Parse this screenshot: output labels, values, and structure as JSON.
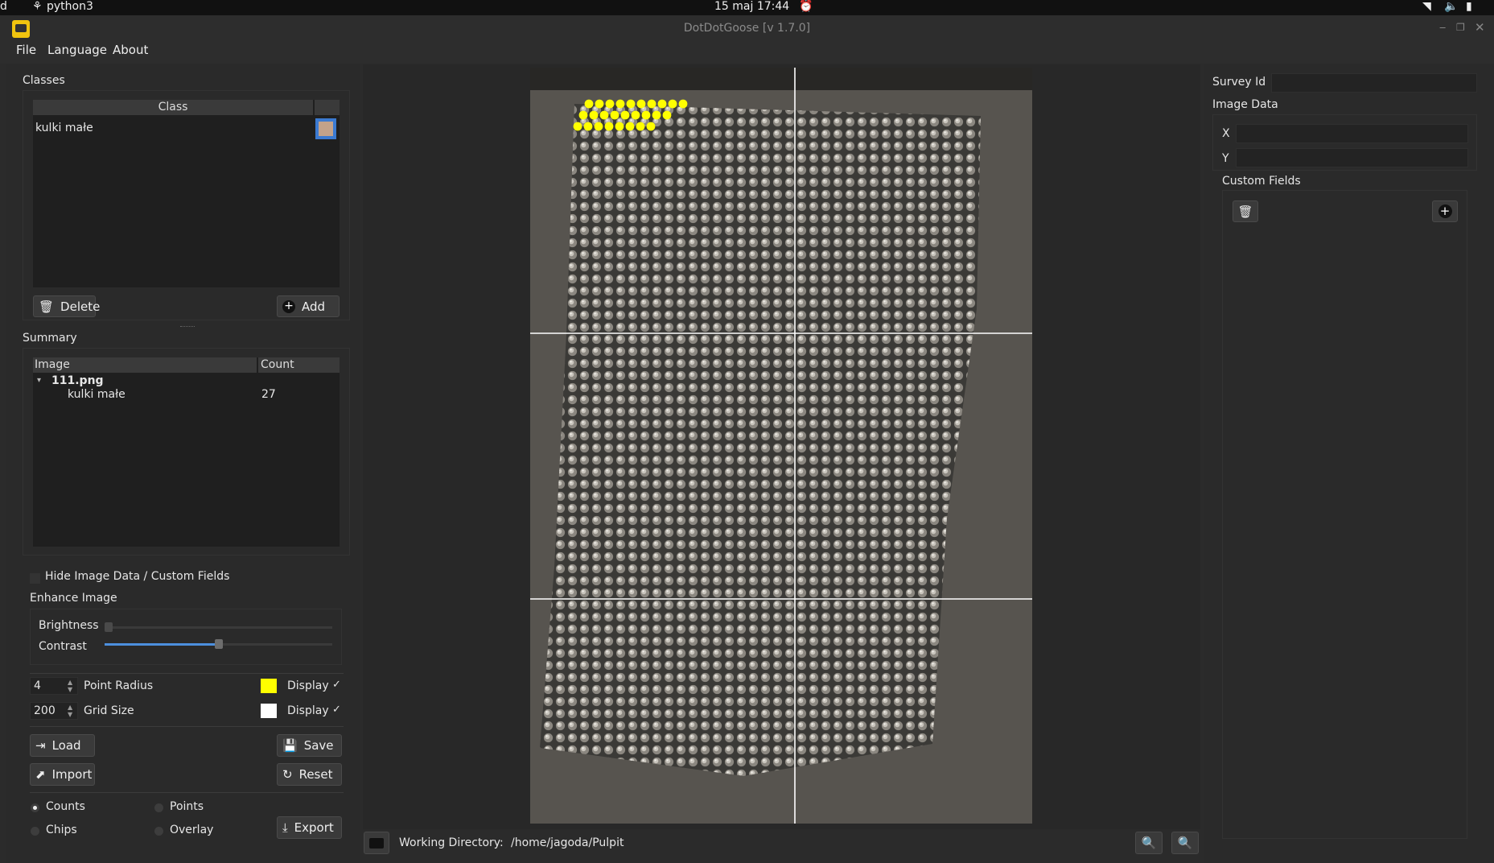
{
  "system_bar": {
    "left_fragment": "d",
    "app_name": "python3",
    "clock": "15 maj  17:44"
  },
  "window": {
    "title": "DotDotGoose [v 1.7.0]"
  },
  "menu": [
    "File",
    "Language",
    "About"
  ],
  "classes": {
    "section_label": "Classes",
    "column_header": "Class",
    "rows": [
      {
        "name": "kulki małe",
        "color": "#c2a28a"
      }
    ],
    "delete_label": "Delete",
    "add_label": "Add"
  },
  "summary": {
    "section_label": "Summary",
    "columns": [
      "Image",
      "Count"
    ],
    "image_name": "111.png",
    "rows": [
      {
        "class": "kulki małe",
        "count": "27"
      }
    ]
  },
  "options": {
    "hide_label": "Hide Image Data / Custom Fields",
    "enhance_label": "Enhance Image",
    "brightness_label": "Brightness",
    "contrast_label": "Contrast",
    "brightness_value": 0.0,
    "contrast_value": 0.5,
    "point_radius_value": "4",
    "point_radius_label": "Point Radius",
    "point_color": "#ffff00",
    "display_label": "Display",
    "check_mark": "✓",
    "grid_size_value": "200",
    "grid_size_label": "Grid Size",
    "grid_color": "#ffffff"
  },
  "actions": {
    "load_label": "Load",
    "save_label": "Save",
    "import_label": "Import",
    "reset_label": "Reset",
    "export_label": "Export",
    "export_options": [
      "Counts",
      "Points",
      "Chips",
      "Overlay"
    ],
    "selected_export": "Counts"
  },
  "viewer": {
    "working_dir_label": "Working Directory:",
    "working_dir_path": "/home/jagoda/Pulpit"
  },
  "right_panel": {
    "survey_id_label": "Survey Id",
    "image_data_label": "Image Data",
    "x_label": "X",
    "y_label": "Y",
    "custom_fields_label": "Custom Fields"
  }
}
